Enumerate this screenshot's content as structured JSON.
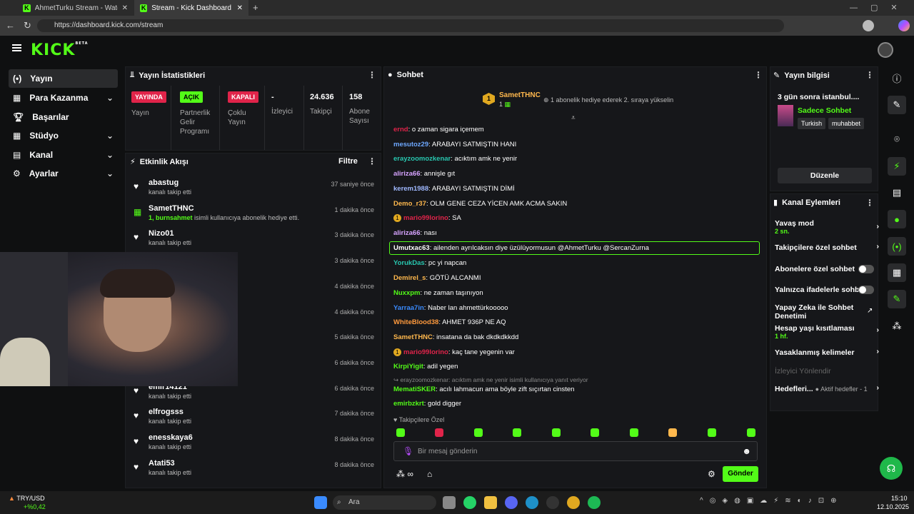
{
  "browser": {
    "tabs": [
      {
        "title": "AhmetTurku Stream - Watch Live"
      },
      {
        "title": "Stream - Kick Dashboard"
      }
    ],
    "url": "https://dashboard.kick.com/stream"
  },
  "app": {
    "logo": "KICK",
    "logo_badge": "BETA",
    "accent": "#53fc18"
  },
  "sidebar": {
    "items": [
      {
        "label": "Yayın",
        "icon": "broadcast-icon"
      },
      {
        "label": "Para Kazanma",
        "icon": "money-icon"
      },
      {
        "label": "Başarılar",
        "icon": "trophy-icon"
      },
      {
        "label": "Stüdyo",
        "icon": "grid-icon"
      },
      {
        "label": "Kanal",
        "icon": "bars-icon"
      },
      {
        "label": "Ayarlar",
        "icon": "gear-icon"
      }
    ]
  },
  "stats": {
    "title": "Yayın İstatistikleri",
    "cells": [
      {
        "value": "YAYINDA",
        "label": "Yayın",
        "color": "#e0244a"
      },
      {
        "value": "AÇIK",
        "label": "Partnerlik Gelir Programı",
        "color": "#53fc18"
      },
      {
        "value": "KAPALI",
        "label": "Çoklu Yayın",
        "color": "#e0244a"
      },
      {
        "value": "-",
        "label": "İzleyici"
      },
      {
        "value": "24.636",
        "label": "Takipçi"
      },
      {
        "value": "158",
        "label": "Abone Sayısı"
      }
    ]
  },
  "activity": {
    "title": "Etkinlik Akışı",
    "filter": "Filtre",
    "items": [
      {
        "name": "abastug",
        "desc": "kanalı takip etti",
        "time": "37 saniye önce"
      },
      {
        "name": "SametTHNC",
        "desc_hl": "1, burnsahmet",
        "desc": " isimli kullanıcıya abonelik hediye etti.",
        "time": "1 dakika önce"
      },
      {
        "name": "Nizo01",
        "desc": "kanalı takip etti",
        "time": "3 dakika önce"
      },
      {
        "time": "3 dakika önce"
      },
      {
        "time": "4 dakika önce"
      },
      {
        "time": "4 dakika önce"
      },
      {
        "time": "5 dakika önce"
      },
      {
        "time": "6 dakika önce"
      },
      {
        "name": "emir14121",
        "desc": "kanalı takip etti",
        "time": "6 dakika önce"
      },
      {
        "name": "elfrogsss",
        "desc": "kanalı takip etti",
        "time": "7 dakika önce"
      },
      {
        "name": "enesskaya6",
        "desc": "kanalı takip etti",
        "time": "8 dakika önce"
      },
      {
        "name": "Atati53",
        "desc": "kanalı takip etti",
        "time": "8 dakika önce"
      }
    ]
  },
  "chat": {
    "title": "Sohbet",
    "pinned_user": "SametTHNC",
    "pinned_count": "1",
    "pinned_rank": "1",
    "pinned_text": "1 abonelik hediye ederek 2. sıraya yükselin",
    "messages": [
      {
        "user": "ernd",
        "color": "#e0244a",
        "text": ": o zaman sigara içemem"
      },
      {
        "user": "mesutoz29",
        "color": "#6ea8ff",
        "text": ": ARABAYI SATMIŞTIN HANI"
      },
      {
        "user": "erayzoomozkenar",
        "color": "#28c7b0",
        "text": ": acıktım amk ne yenir"
      },
      {
        "user": "aliriza66",
        "color": "#d6a3ff",
        "text": ": annişle gıt"
      },
      {
        "user": "kerem1988",
        "color": "#9fb8ff",
        "text": ": ARABAYI SATMIŞTIN DİMİ"
      },
      {
        "user": "Demo_r37",
        "color": "#ffb84d",
        "text": ": OLM GENE CEZA YİCEN AMK ACMA SAKIN"
      },
      {
        "user": "mario99lorino",
        "color": "#e0244a",
        "text": ": SA",
        "badge": "1"
      },
      {
        "user": "aliriza66",
        "color": "#d6a3ff",
        "text": ": nası"
      },
      {
        "user": "Umutxac63",
        "color": "#ffffff",
        "text": ": ailenden ayrılcaksın diye üzülüyormusun @AhmetTurku @SercanZurna"
      },
      {
        "user": "YorukDas",
        "color": "#28c7b0",
        "text": ": pc yi napcan"
      },
      {
        "user": "Demirel_s",
        "color": "#ffb84d",
        "text": ": GÖTÜ ALCANMI"
      },
      {
        "user": "Nuxxpm",
        "color": "#53fc18",
        "text": ": ne zaman taşınıyon"
      },
      {
        "user": "Yarraa7in",
        "color": "#3a8bff",
        "text": ": Naber lan ahmettürkooooo"
      },
      {
        "user": "WhiteBlood38",
        "color": "#ff9a3d",
        "text": ": AHMET 936P NE AQ"
      },
      {
        "user": "SametTHNC",
        "color": "#ffb84d",
        "text": ": insatana da bak dkdkdkkdd"
      },
      {
        "user": "mario99lorino",
        "color": "#e0244a",
        "text": ": kaç tane yegenin var",
        "badge": "1"
      },
      {
        "user": "KirpiYigit",
        "color": "#53fc18",
        "text": ": adil yegen"
      },
      {
        "user": "MematiSKER",
        "color": "#53fc18",
        "text": ": acılı lahmacun ama böyle zift sıçırtan cinsten",
        "reply": "erayzoomozkenar: acıktım amk ne yenir isimli kullanıcıya yanıt veriyor"
      },
      {
        "user": "emirbzkrt",
        "color": "#53fc18",
        "text": ": gold digger"
      }
    ],
    "followers_only": "Takipçilere Özel",
    "input_placeholder": "Bir mesaj gönderin",
    "send": "Gönder"
  },
  "stream_info": {
    "title": "Yayın bilgisi",
    "stream_title": "3 gün sonra istanbul....",
    "category": "Sadece Sohbet",
    "tags": [
      "Turkish",
      "muhabbet"
    ],
    "edit": "Düzenle"
  },
  "channel_actions": {
    "title": "Kanal Eylemleri",
    "items": [
      {
        "label": "Yavaş mod",
        "sub": "2 sn.",
        "control": "chevron"
      },
      {
        "label": "Takipçilere özel sohbet",
        "control": "chevron"
      },
      {
        "label": "Abonelere özel sohbet",
        "control": "toggle"
      },
      {
        "label": "Yalnızca ifadelerle sohbet",
        "control": "toggle"
      },
      {
        "label": "Yapay Zeka ile Sohbet Denetimi",
        "control": "external"
      },
      {
        "label": "Hesap yaşı kısıtlaması",
        "sub": "1 hf.",
        "control": "chevron"
      },
      {
        "label": "Yasaklanmış kelimeler",
        "control": "chevron"
      },
      {
        "label": "İzleyici Yönlendir",
        "control": "none"
      },
      {
        "label": "Hedefleri...",
        "sub": "Aktif hedefler - 1",
        "control": "chevron"
      }
    ]
  },
  "taskbar": {
    "ticker": "TRY/USD",
    "ticker_change": "+%0,42",
    "search": "Ara",
    "time": "15:10",
    "date": "12.10.2025"
  }
}
